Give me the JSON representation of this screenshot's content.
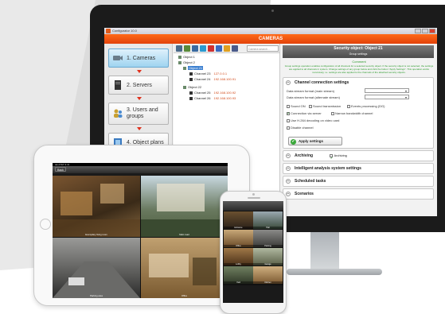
{
  "app": {
    "window_title": "Configurator 10.0",
    "section_title": "CAMERAS"
  },
  "nav": {
    "items": [
      {
        "label": "1. Cameras",
        "icon": "camera-icon",
        "active": true
      },
      {
        "label": "2. Servers",
        "icon": "server-icon",
        "active": false
      },
      {
        "label": "3. Users and groups",
        "icon": "users-icon",
        "active": false
      },
      {
        "label": "4. Object plans",
        "icon": "map-icon",
        "active": false
      }
    ]
  },
  "tree": {
    "search_placeholder": "Camera search...",
    "rows": [
      {
        "label": "Object 1",
        "ip": "",
        "selected": false
      },
      {
        "label": "Object 2",
        "ip": "",
        "selected": false
      },
      {
        "label": "Object 21",
        "ip": "",
        "selected": true
      },
      {
        "label": "Channel 23",
        "ip": "127.0.0.1",
        "selected": false
      },
      {
        "label": "Channel 24",
        "ip": "192.168.100.91",
        "selected": false
      },
      {
        "label": "Object 22",
        "ip": "",
        "selected": false
      },
      {
        "label": "Channel 25",
        "ip": "192.168.100.92",
        "selected": false
      },
      {
        "label": "Channel 26",
        "ip": "192.168.100.93",
        "selected": false
      }
    ]
  },
  "props": {
    "header_title": "Security object:  Object 21",
    "header_subtitle": "Group settings",
    "comment_title": "Comment",
    "comment_text": "Group settings operation enables configuration of all channels for a selected security object. If the security object is not selected, the settings are applied to all channels in system. Change settings of any group below and click the button \"Apply Settings\". This operation works recursively, i.e. settings are also applied to the channels of the attached security objects.",
    "channel_group_title": "Channel connection settings",
    "data_stream_main": "Data stream format (main stream)",
    "data_stream_alt": "Data stream format (alternate stream)",
    "checkboxes": [
      {
        "label": "Sound ON",
        "checked": false
      },
      {
        "label": "Sound transmission",
        "checked": false
      },
      {
        "label": "Events processing (DG)",
        "checked": false
      },
      {
        "label": "Connection via server",
        "checked": true
      },
      {
        "label": "Narrow bandwidth channel",
        "checked": false
      },
      {
        "label": "Use H.264 decoding on video card",
        "checked": false
      },
      {
        "label": "Disable channel",
        "checked": false
      }
    ],
    "apply_label": "Apply settings",
    "archiving_title": "Archiving",
    "archiving_check": "Archiving",
    "intelligent_title": "Intelligent analysis system settings",
    "scheduled_title": "Scheduled tasks",
    "scenarios_title": "Scenarios"
  },
  "tablet": {
    "status": "●● AT&T  9:41",
    "back_label": "Back",
    "captions": [
      "Exemplary living room",
      "Main road",
      "Parking area",
      "Office"
    ]
  },
  "phone": {
    "captions": [
      "Entrance",
      "Hall",
      "Office",
      "Parking",
      "Lobby",
      "Garage",
      "Yard",
      "Kitchen"
    ]
  },
  "colors": {
    "accent": "#e2420a",
    "nav_active": "#9fd4f0",
    "ip_text": "#d24a1a",
    "comment_green": "#2a9a2a"
  }
}
